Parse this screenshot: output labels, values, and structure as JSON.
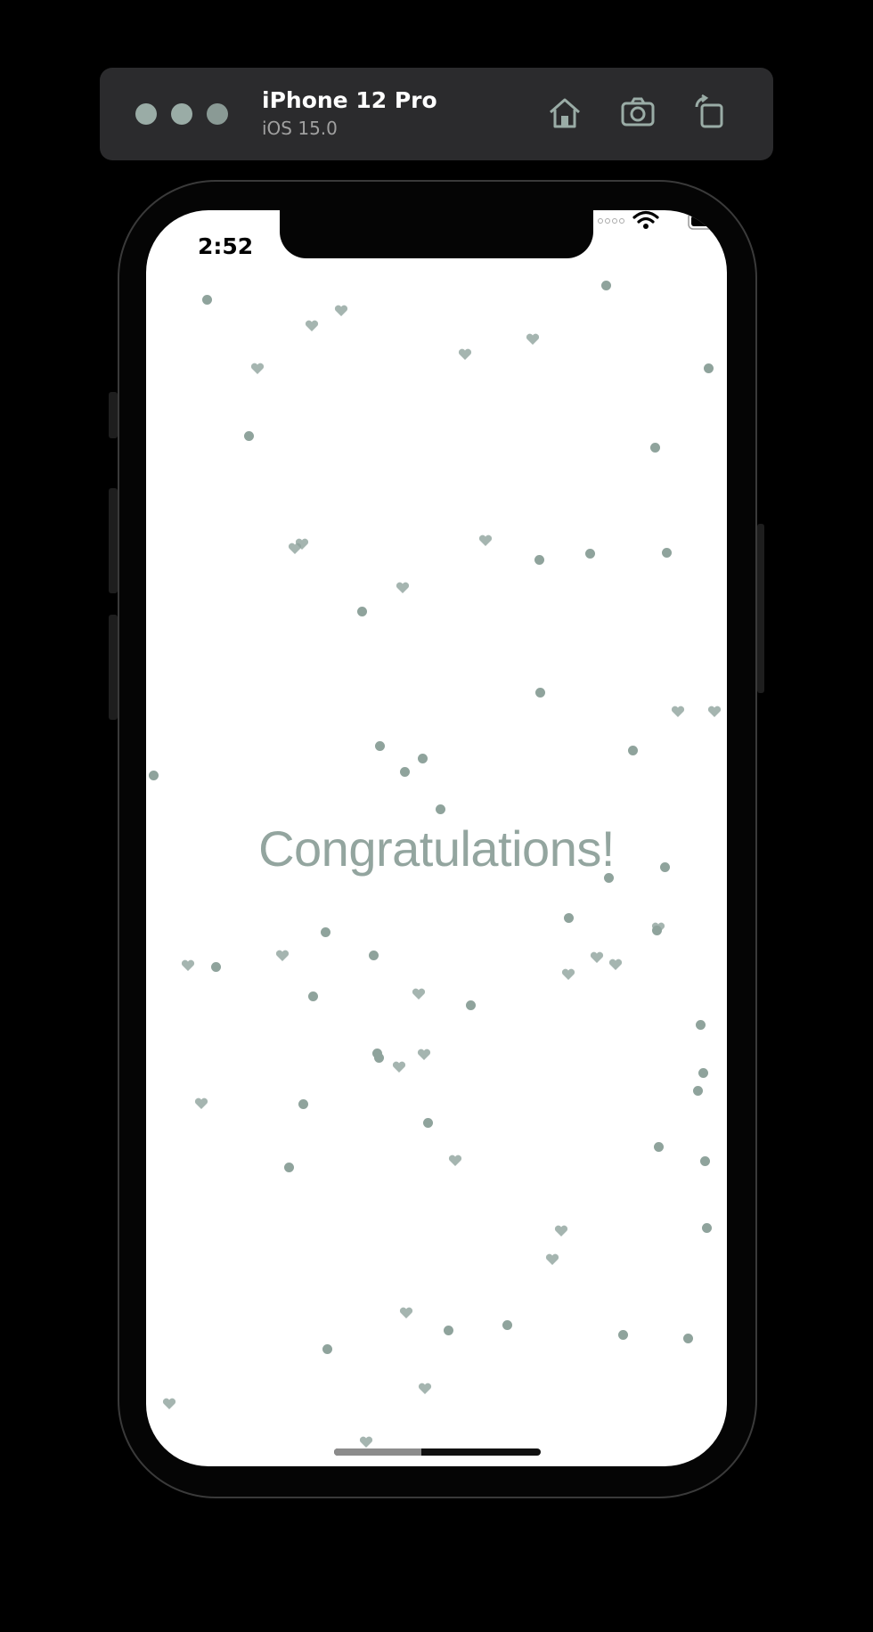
{
  "simulator": {
    "device_name": "iPhone 12 Pro",
    "os_version": "iOS 15.0",
    "toolbar_icons": [
      "home-icon",
      "screenshot-icon",
      "rotate-icon"
    ]
  },
  "status_bar": {
    "time": "2:52",
    "icons": [
      "cellular-signal-icon",
      "wifi-icon",
      "battery-icon"
    ]
  },
  "content": {
    "message": "Congratulations!"
  },
  "colors": {
    "accent": "#93a59f",
    "particle": "#8fa39c",
    "screen_background": "#ffffff",
    "window_chrome": "#2b2b2d"
  },
  "confetti": {
    "shapes": [
      "dot",
      "heart"
    ]
  }
}
